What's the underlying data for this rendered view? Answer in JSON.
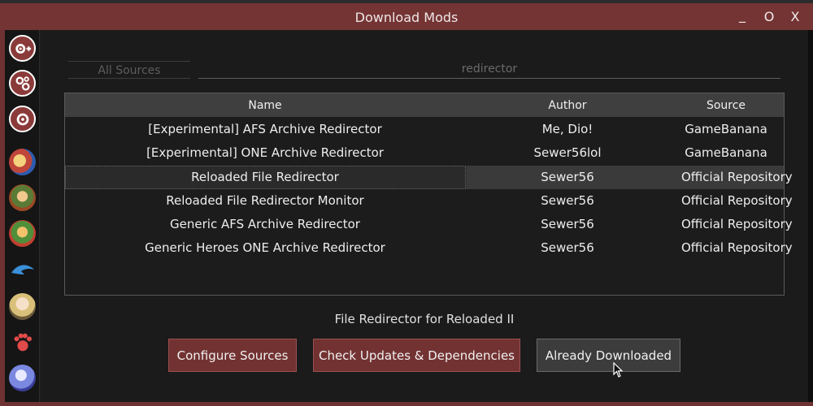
{
  "window": {
    "title": "Download Mods",
    "min": "_",
    "max": "O",
    "close": "X"
  },
  "filters": {
    "source": "All Sources",
    "search": "redirector"
  },
  "table": {
    "headers": {
      "name": "Name",
      "author": "Author",
      "source": "Source"
    },
    "rows": [
      {
        "name": "[Experimental] AFS Archive Redirector",
        "author": "Me, Dio!",
        "source": "GameBanana"
      },
      {
        "name": "[Experimental] ONE Archive Redirector",
        "author": "Sewer56lol",
        "source": "GameBanana"
      },
      {
        "name": "Reloaded File Redirector",
        "author": "Sewer56",
        "source": "Official Repository"
      },
      {
        "name": "Reloaded File Redirector Monitor",
        "author": "Sewer56",
        "source": "Official Repository"
      },
      {
        "name": "Generic AFS Archive Redirector",
        "author": "Sewer56",
        "source": "Official Repository"
      },
      {
        "name": "Generic Heroes ONE Archive Redirector",
        "author": "Sewer56",
        "source": "Official Repository"
      }
    ]
  },
  "description": "File Redirector for Reloaded II",
  "buttons": {
    "configure": "Configure Sources",
    "check": "Check Updates & Dependencies",
    "downloaded": "Already Downloaded"
  },
  "sidebar": {
    "icons": [
      "gear-add-icon",
      "gears-icon",
      "gear-icon",
      "game-icon-1",
      "game-icon-2",
      "game-icon-3",
      "dolphin-icon",
      "character-icon",
      "paw-icon",
      "crystal-icon"
    ]
  },
  "colors": {
    "accent": "#743434",
    "frame": "#6e3232",
    "panel": "#1b1b1b"
  }
}
